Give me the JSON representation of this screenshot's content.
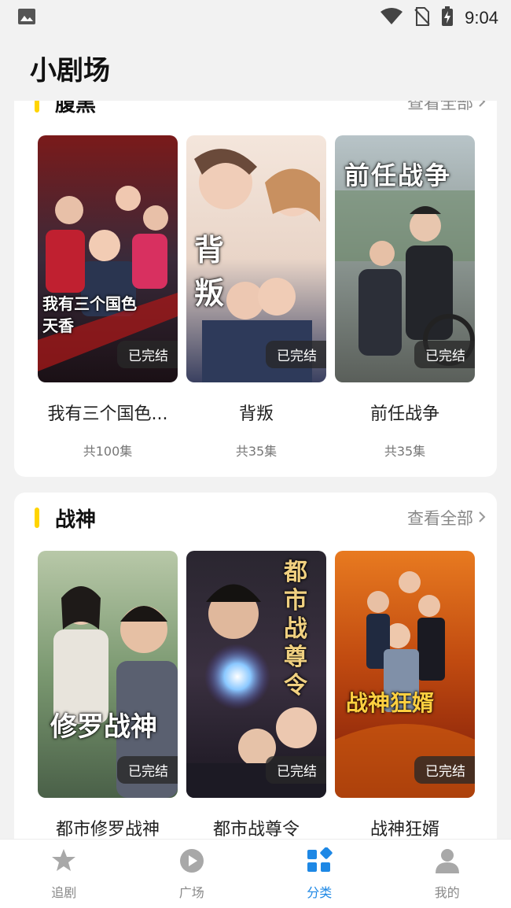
{
  "status_bar": {
    "time": "9:04"
  },
  "page": {
    "title": "小剧场"
  },
  "sections": [
    {
      "title": "腹黑",
      "see_all": "查看全部",
      "items": [
        {
          "title": "我有三个国色...",
          "episodes": "共100集",
          "badge": "已完结",
          "poster_text": "我有三个国色天香"
        },
        {
          "title": "背叛",
          "episodes": "共35集",
          "badge": "已完结",
          "poster_text": "背 叛"
        },
        {
          "title": "前任战争",
          "episodes": "共35集",
          "badge": "已完结",
          "poster_text": "前任战争"
        }
      ]
    },
    {
      "title": "战神",
      "see_all": "查看全部",
      "items": [
        {
          "title": "都市修罗战神",
          "episodes": "",
          "badge": "已完结",
          "poster_text": "修罗战神"
        },
        {
          "title": "都市战尊令",
          "episodes": "",
          "badge": "已完结",
          "poster_text": "都市战尊令"
        },
        {
          "title": "战神狂婿",
          "episodes": "",
          "badge": "已完结",
          "poster_text": "战神狂婿"
        }
      ]
    }
  ],
  "bottom_nav": [
    {
      "label": "追剧",
      "icon": "star-icon",
      "active": false
    },
    {
      "label": "广场",
      "icon": "play-icon",
      "active": false
    },
    {
      "label": "分类",
      "icon": "category-icon",
      "active": true
    },
    {
      "label": "我的",
      "icon": "person-icon",
      "active": false
    }
  ],
  "colors": {
    "accent": "#ffd400",
    "active_tab": "#1e88e5"
  }
}
